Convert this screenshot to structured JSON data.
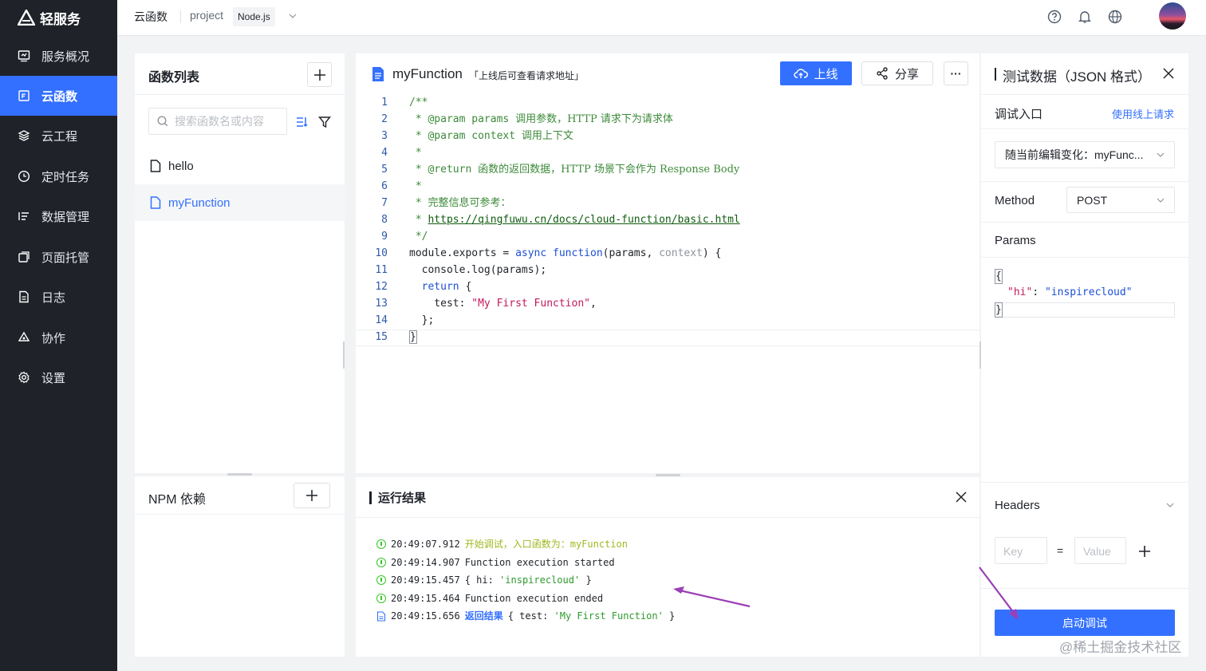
{
  "app": {
    "name": "轻服务"
  },
  "sidebar": {
    "items": [
      {
        "label": "服务概况",
        "icon": "dashboard-icon"
      },
      {
        "label": "云函数",
        "icon": "function-icon",
        "active": true
      },
      {
        "label": "云工程",
        "icon": "layers-icon"
      },
      {
        "label": "定时任务",
        "icon": "clock-icon"
      },
      {
        "label": "数据管理",
        "icon": "data-icon"
      },
      {
        "label": "页面托管",
        "icon": "window-icon"
      },
      {
        "label": "日志",
        "icon": "log-icon"
      },
      {
        "label": "协作",
        "icon": "collab-icon"
      },
      {
        "label": "设置",
        "icon": "settings-icon"
      }
    ]
  },
  "topbar": {
    "breadcrumb": "云函数",
    "project": "project",
    "runtime": "Node.js"
  },
  "function_list": {
    "title": "函数列表",
    "search_placeholder": "搜索函数名或内容",
    "items": [
      {
        "name": "hello"
      },
      {
        "name": "myFunction",
        "selected": true
      }
    ]
  },
  "npm": {
    "title": "NPM 依赖"
  },
  "editor": {
    "file_name": "myFunction",
    "hint": "「上线后可查看请求地址」",
    "deploy_label": "上线",
    "share_label": "分享",
    "more_label": "···",
    "line_numbers": [
      "1",
      "2",
      "3",
      "4",
      "5",
      "6",
      "7",
      "8",
      "9",
      "10",
      "11",
      "12",
      "13",
      "14",
      "15"
    ],
    "code": {
      "l1": "/**",
      "l2a": " * @param params ",
      "l2b": "调用参数，HTTP 请求下为请求体",
      "l3a": " * @param context ",
      "l3b": "调用上下文",
      "l4": " *",
      "l5a": " * @return ",
      "l5b": "函数的返回数据，HTTP 场景下会作为 Response Body",
      "l6": " *",
      "l7a": " * ",
      "l7b": "完整信息可参考：",
      "l8a": " * ",
      "l8b": "https://qingfuwu.cn/docs/cloud-function/basic.html",
      "l9": " */",
      "l10a": "module.exports = ",
      "l10b": "async",
      "l10c": " ",
      "l10d": "function",
      "l10e": "(params, ",
      "l10f": "context",
      "l10g": ") {",
      "l11": "  console.log(params);",
      "l12a": "  ",
      "l12b": "return",
      "l12c": " {",
      "l13a": "    test: ",
      "l13b": "\"My First Function\"",
      "l13c": ",",
      "l14": "  };",
      "l15": "}"
    }
  },
  "results": {
    "title": "运行结果",
    "logs": [
      {
        "time": "20:49:07.912",
        "text": "开始调试，入口函数为：",
        "fn": "myFunction"
      },
      {
        "time": "20:49:14.907",
        "text": "Function execution started"
      },
      {
        "time": "20:49:15.457",
        "text_a": "{ hi: ",
        "text_b": "'inspirecloud'",
        "text_c": " }"
      },
      {
        "time": "20:49:15.464",
        "text": "Function execution ended"
      },
      {
        "time": "20:49:15.656",
        "label": "返回结果",
        "text_a": "{ test: ",
        "text_b": "'My First Function'",
        "text_c": " }"
      }
    ]
  },
  "test_panel": {
    "title": "测试数据（JSON 格式）",
    "entry_label": "调试入口",
    "use_online_link": "使用线上请求",
    "entry_select": "随当前编辑变化：myFunc...",
    "method_label": "Method",
    "method_value": "POST",
    "params_label": "Params",
    "params_json": {
      "open": "{",
      "key": "\"hi\"",
      "colon": ": ",
      "value": "\"inspirecloud\"",
      "close": "}"
    },
    "headers_label": "Headers",
    "key_placeholder": "Key",
    "value_placeholder": "Value",
    "equals": "=",
    "run_button": "启动调试"
  },
  "watermark": "@稀土掘金技术社区",
  "colors": {
    "accent": "#3370ff",
    "sidebar_bg": "#1f2329",
    "success": "#34c724",
    "annotation_arrow": "#9b3fb5"
  }
}
